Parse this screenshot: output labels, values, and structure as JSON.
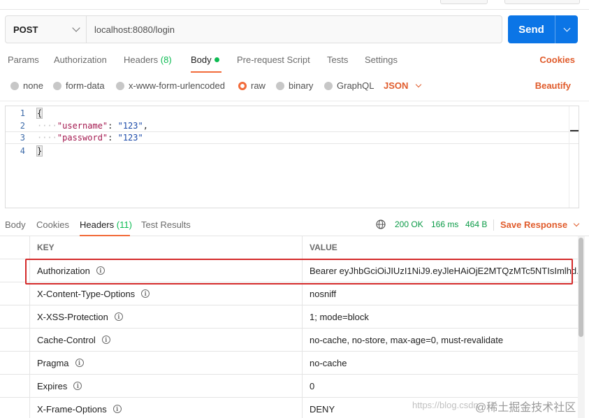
{
  "request": {
    "method": "POST",
    "url": "localhost:8080/login",
    "send_label": "Send"
  },
  "request_tabs": [
    {
      "label": "Params"
    },
    {
      "label": "Authorization"
    },
    {
      "label": "Headers",
      "count": "(8)"
    },
    {
      "label": "Body",
      "active": true
    },
    {
      "label": "Pre-request Script"
    },
    {
      "label": "Tests"
    },
    {
      "label": "Settings"
    }
  ],
  "cookies_label": "Cookies",
  "body_types": [
    "none",
    "form-data",
    "x-www-form-urlencoded",
    "raw",
    "binary",
    "GraphQL"
  ],
  "body_type_selected": "raw",
  "format_label": "JSON",
  "beautify_label": "Beautify",
  "editor": {
    "line_numbers": [
      "1",
      "2",
      "3",
      "4"
    ],
    "open_brace": "{",
    "close_brace": "}",
    "line2_key": "\"username\"",
    "line2_sep": ": ",
    "line2_value": "\"123\"",
    "line2_tail": ",",
    "line3_key": "\"password\"",
    "line3_sep": ": ",
    "line3_value": "\"123\"",
    "indent": "····"
  },
  "response_tabs": [
    {
      "label": "Body"
    },
    {
      "label": "Cookies"
    },
    {
      "label": "Headers",
      "count": "(11)",
      "active": true
    },
    {
      "label": "Test Results"
    }
  ],
  "response_meta": {
    "status": "200 OK",
    "time": "166 ms",
    "size": "464 B",
    "save_label": "Save Response"
  },
  "headers_table": {
    "col_key": "KEY",
    "col_value": "VALUE",
    "rows": [
      {
        "key": "Authorization",
        "value": "Bearer eyJhbGciOiJIUzI1NiJ9.eyJleHAiOjE2MTQzMTc5NTIsImlhd..."
      },
      {
        "key": "X-Content-Type-Options",
        "value": "nosniff"
      },
      {
        "key": "X-XSS-Protection",
        "value": "1; mode=block"
      },
      {
        "key": "Cache-Control",
        "value": "no-cache, no-store, max-age=0, must-revalidate"
      },
      {
        "key": "Pragma",
        "value": "no-cache"
      },
      {
        "key": "Expires",
        "value": "0"
      },
      {
        "key": "X-Frame-Options",
        "value": "DENY"
      }
    ]
  },
  "watermark": {
    "url": "https://blog.csdn",
    "brand": "@稀土掘金技术社区"
  },
  "colors": {
    "accent": "#f26b3a",
    "send": "#0b75e6",
    "status": "#0a9a46",
    "highlight": "#d42a2a"
  }
}
